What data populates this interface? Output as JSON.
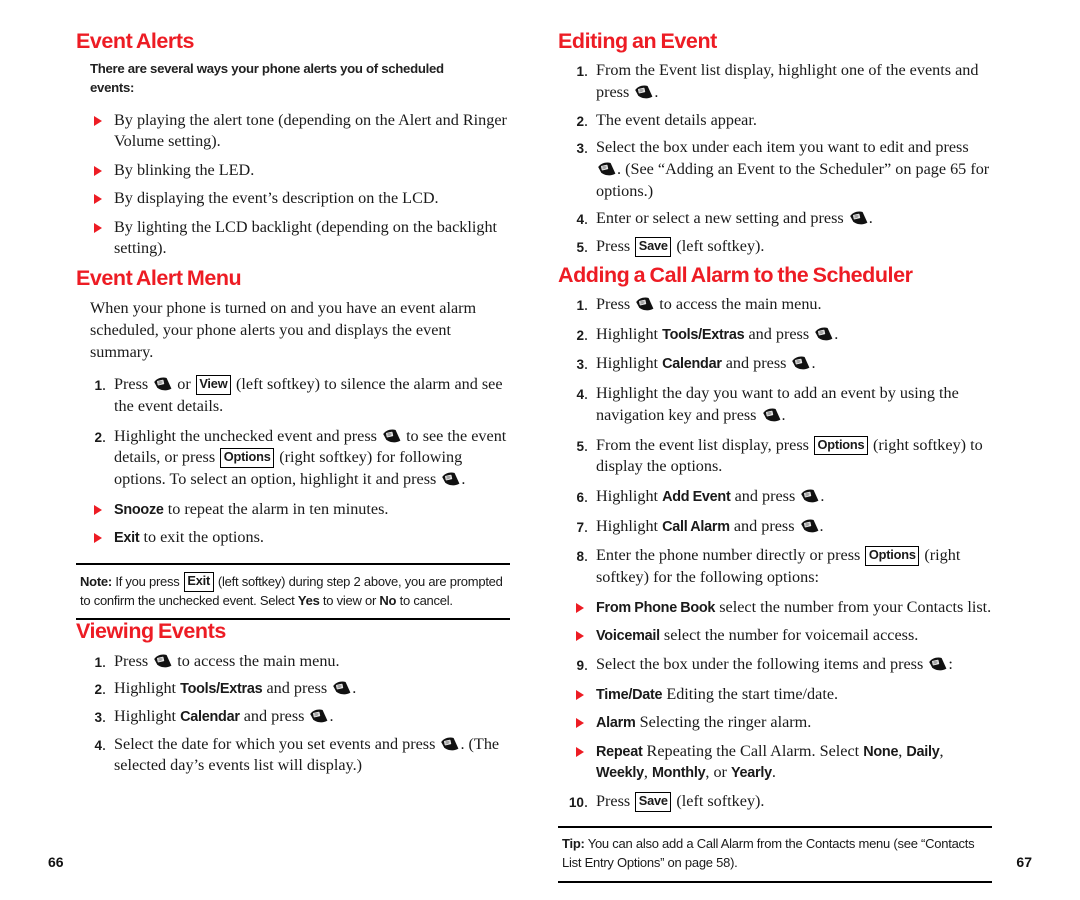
{
  "meta": {
    "accent_red": "#ED1C24",
    "text_color": "#1a1a1a",
    "icon_name": "phone-ok-key-icon"
  },
  "left_page": {
    "folio": "66",
    "sections": [
      {
        "title": "Event Alerts",
        "intro": "There are several ways your phone alerts you of scheduled events:",
        "bullets": [
          "By playing the alert tone (depending on the Alert and Ringer Volume setting).",
          "By blinking the LED.",
          "By displaying the event’s description on the LCD.",
          "By lighting the LCD backlight (depending on the backlight setting)."
        ]
      },
      {
        "title": "Event Alert Menu",
        "paragraph": "When your phone is turned on and you have an event alarm scheduled, your phone alerts you and displays the event summary.",
        "steps": [
          {
            "number": "1.",
            "parts": [
              {
                "t": "text",
                "v": "Press "
              },
              {
                "t": "key"
              },
              {
                "t": "text",
                "v": " or "
              },
              {
                "t": "softkey",
                "v": "View"
              },
              {
                "t": "text",
                "v": " (left softkey) to silence the alarm and see the event details."
              }
            ]
          },
          {
            "number": "2.",
            "parts": [
              {
                "t": "text",
                "v": "Highlight the unchecked event and press "
              },
              {
                "t": "key"
              },
              {
                "t": "text",
                "v": " to see the event details, or press "
              },
              {
                "t": "softkey",
                "v": "Options"
              },
              {
                "t": "text",
                "v": " (right softkey) for following options. To select an option, highlight it and press "
              },
              {
                "t": "key"
              },
              {
                "t": "text",
                "v": "."
              }
            ]
          }
        ],
        "sub_bullets": [
          {
            "bold": "Snooze",
            "rest": " to repeat the alarm in ten minutes."
          },
          {
            "bold": "Exit",
            "rest": " to exit the options."
          }
        ],
        "note": {
          "label": "Note:",
          "parts": [
            {
              "t": "text",
              "v": " If you press "
            },
            {
              "t": "softkey",
              "v": "Exit"
            },
            {
              "t": "text",
              "v": " (left softkey) during step 2 above, you are prompted to confirm the unchecked event. Select "
            },
            {
              "t": "bold",
              "v": "Yes"
            },
            {
              "t": "text",
              "v": " to view or "
            },
            {
              "t": "bold",
              "v": "No"
            },
            {
              "t": "text",
              "v": " to cancel."
            }
          ]
        }
      },
      {
        "title": "Viewing Events",
        "steps": [
          {
            "number": "1.",
            "parts": [
              {
                "t": "text",
                "v": "Press "
              },
              {
                "t": "key"
              },
              {
                "t": "text",
                "v": " to access the main menu."
              }
            ]
          },
          {
            "number": "2.",
            "parts": [
              {
                "t": "text",
                "v": "Highlight "
              },
              {
                "t": "mi",
                "v": "Tools/Extras"
              },
              {
                "t": "text",
                "v": " and press "
              },
              {
                "t": "key"
              },
              {
                "t": "text",
                "v": "."
              }
            ]
          },
          {
            "number": "3.",
            "parts": [
              {
                "t": "text",
                "v": "Highlight "
              },
              {
                "t": "mi",
                "v": "Calendar"
              },
              {
                "t": "text",
                "v": " and press "
              },
              {
                "t": "key"
              },
              {
                "t": "text",
                "v": "."
              }
            ]
          },
          {
            "number": "4.",
            "parts": [
              {
                "t": "text",
                "v": "Select the date for which you set events and press "
              },
              {
                "t": "key"
              },
              {
                "t": "text",
                "v": ". (The selected day’s events list will display.)"
              }
            ]
          }
        ]
      }
    ]
  },
  "right_page": {
    "folio": "67",
    "sections": [
      {
        "title": "Editing an Event",
        "steps": [
          {
            "number": "1.",
            "parts": [
              {
                "t": "text",
                "v": "From the Event list display, highlight one of the events and press "
              },
              {
                "t": "key"
              },
              {
                "t": "text",
                "v": "."
              }
            ]
          },
          {
            "number": "2.",
            "parts": [
              {
                "t": "text",
                "v": "The event details appear."
              }
            ]
          },
          {
            "number": "3.",
            "parts": [
              {
                "t": "text",
                "v": "Select the box under each item you want to edit and press "
              },
              {
                "t": "key"
              },
              {
                "t": "text",
                "v": ". (See “Adding an Event to the Scheduler” on page 65 for options.)"
              }
            ]
          },
          {
            "number": "4.",
            "parts": [
              {
                "t": "text",
                "v": "Enter or select a new setting and press "
              },
              {
                "t": "key"
              },
              {
                "t": "text",
                "v": "."
              }
            ]
          },
          {
            "number": "5.",
            "parts": [
              {
                "t": "text",
                "v": "Press "
              },
              {
                "t": "softkey",
                "v": "Save"
              },
              {
                "t": "text",
                "v": " (left softkey)."
              }
            ]
          }
        ]
      },
      {
        "title": "Adding a Call Alarm to the Scheduler",
        "steps": [
          {
            "number": "1.",
            "parts": [
              {
                "t": "text",
                "v": "Press "
              },
              {
                "t": "key"
              },
              {
                "t": "text",
                "v": " to access the main menu."
              }
            ]
          },
          {
            "number": "2.",
            "parts": [
              {
                "t": "text",
                "v": "Highlight "
              },
              {
                "t": "mi",
                "v": "Tools/Extras"
              },
              {
                "t": "text",
                "v": " and press "
              },
              {
                "t": "key"
              },
              {
                "t": "text",
                "v": "."
              }
            ]
          },
          {
            "number": "3.",
            "parts": [
              {
                "t": "text",
                "v": "Highlight "
              },
              {
                "t": "mi",
                "v": "Calendar"
              },
              {
                "t": "text",
                "v": " and press "
              },
              {
                "t": "key"
              },
              {
                "t": "text",
                "v": "."
              }
            ]
          },
          {
            "number": "4.",
            "parts": [
              {
                "t": "text",
                "v": "Highlight the day you want to add an event by using the navigation key and press "
              },
              {
                "t": "key"
              },
              {
                "t": "text",
                "v": "."
              }
            ]
          },
          {
            "number": "5.",
            "parts": [
              {
                "t": "text",
                "v": "From the event list display, press "
              },
              {
                "t": "softkey",
                "v": "Options"
              },
              {
                "t": "text",
                "v": " (right softkey) to display the options."
              }
            ]
          },
          {
            "number": "6.",
            "parts": [
              {
                "t": "text",
                "v": "Highlight "
              },
              {
                "t": "mi",
                "v": "Add Event"
              },
              {
                "t": "text",
                "v": " and press "
              },
              {
                "t": "key"
              },
              {
                "t": "text",
                "v": "."
              }
            ]
          },
          {
            "number": "7.",
            "parts": [
              {
                "t": "text",
                "v": "Highlight "
              },
              {
                "t": "mi",
                "v": "Call Alarm"
              },
              {
                "t": "text",
                "v": " and press "
              },
              {
                "t": "key"
              },
              {
                "t": "text",
                "v": "."
              }
            ]
          },
          {
            "number": "8.",
            "parts": [
              {
                "t": "text",
                "v": "Enter the phone number directly or press "
              },
              {
                "t": "softkey",
                "v": "Options"
              },
              {
                "t": "text",
                "v": " (right softkey) for the following options:"
              }
            ]
          }
        ],
        "bullets_after_8": [
          {
            "bold": "From Phone Book",
            "rest": " select the number from your Contacts list."
          },
          {
            "bold": "Voicemail",
            "rest": " select the number for voicemail access."
          }
        ],
        "step_9": {
          "number": "9.",
          "parts": [
            {
              "t": "text",
              "v": "Select the box under the following items and press "
            },
            {
              "t": "key"
            },
            {
              "t": "text",
              "v": ":"
            }
          ]
        },
        "bullets_after_9": [
          {
            "bold": "Time/Date",
            "rest": " Editing the start time/date."
          },
          {
            "bold": "Alarm",
            "rest": " Selecting the ringer alarm."
          },
          {
            "bold": "Repeat",
            "parts": [
              {
                "t": "text",
                "v": " Repeating the Call Alarm. Select "
              },
              {
                "t": "mi",
                "v": "None"
              },
              {
                "t": "text",
                "v": ", "
              },
              {
                "t": "mi",
                "v": "Daily"
              },
              {
                "t": "text",
                "v": ", "
              },
              {
                "t": "mi",
                "v": "Weekly"
              },
              {
                "t": "text",
                "v": ", "
              },
              {
                "t": "mi",
                "v": "Monthly"
              },
              {
                "t": "text",
                "v": ", or "
              },
              {
                "t": "mi",
                "v": "Yearly"
              },
              {
                "t": "text",
                "v": "."
              }
            ]
          }
        ],
        "step_10": {
          "number": "10.",
          "parts": [
            {
              "t": "text",
              "v": "Press "
            },
            {
              "t": "softkey",
              "v": "Save"
            },
            {
              "t": "text",
              "v": " (left softkey)."
            }
          ]
        },
        "tip": {
          "label": "Tip:",
          "parts": [
            {
              "t": "text",
              "v": " You can also add a Call Alarm from the Contacts menu (see “Contacts List Entry Options” on page 58)."
            }
          ]
        }
      }
    ]
  }
}
